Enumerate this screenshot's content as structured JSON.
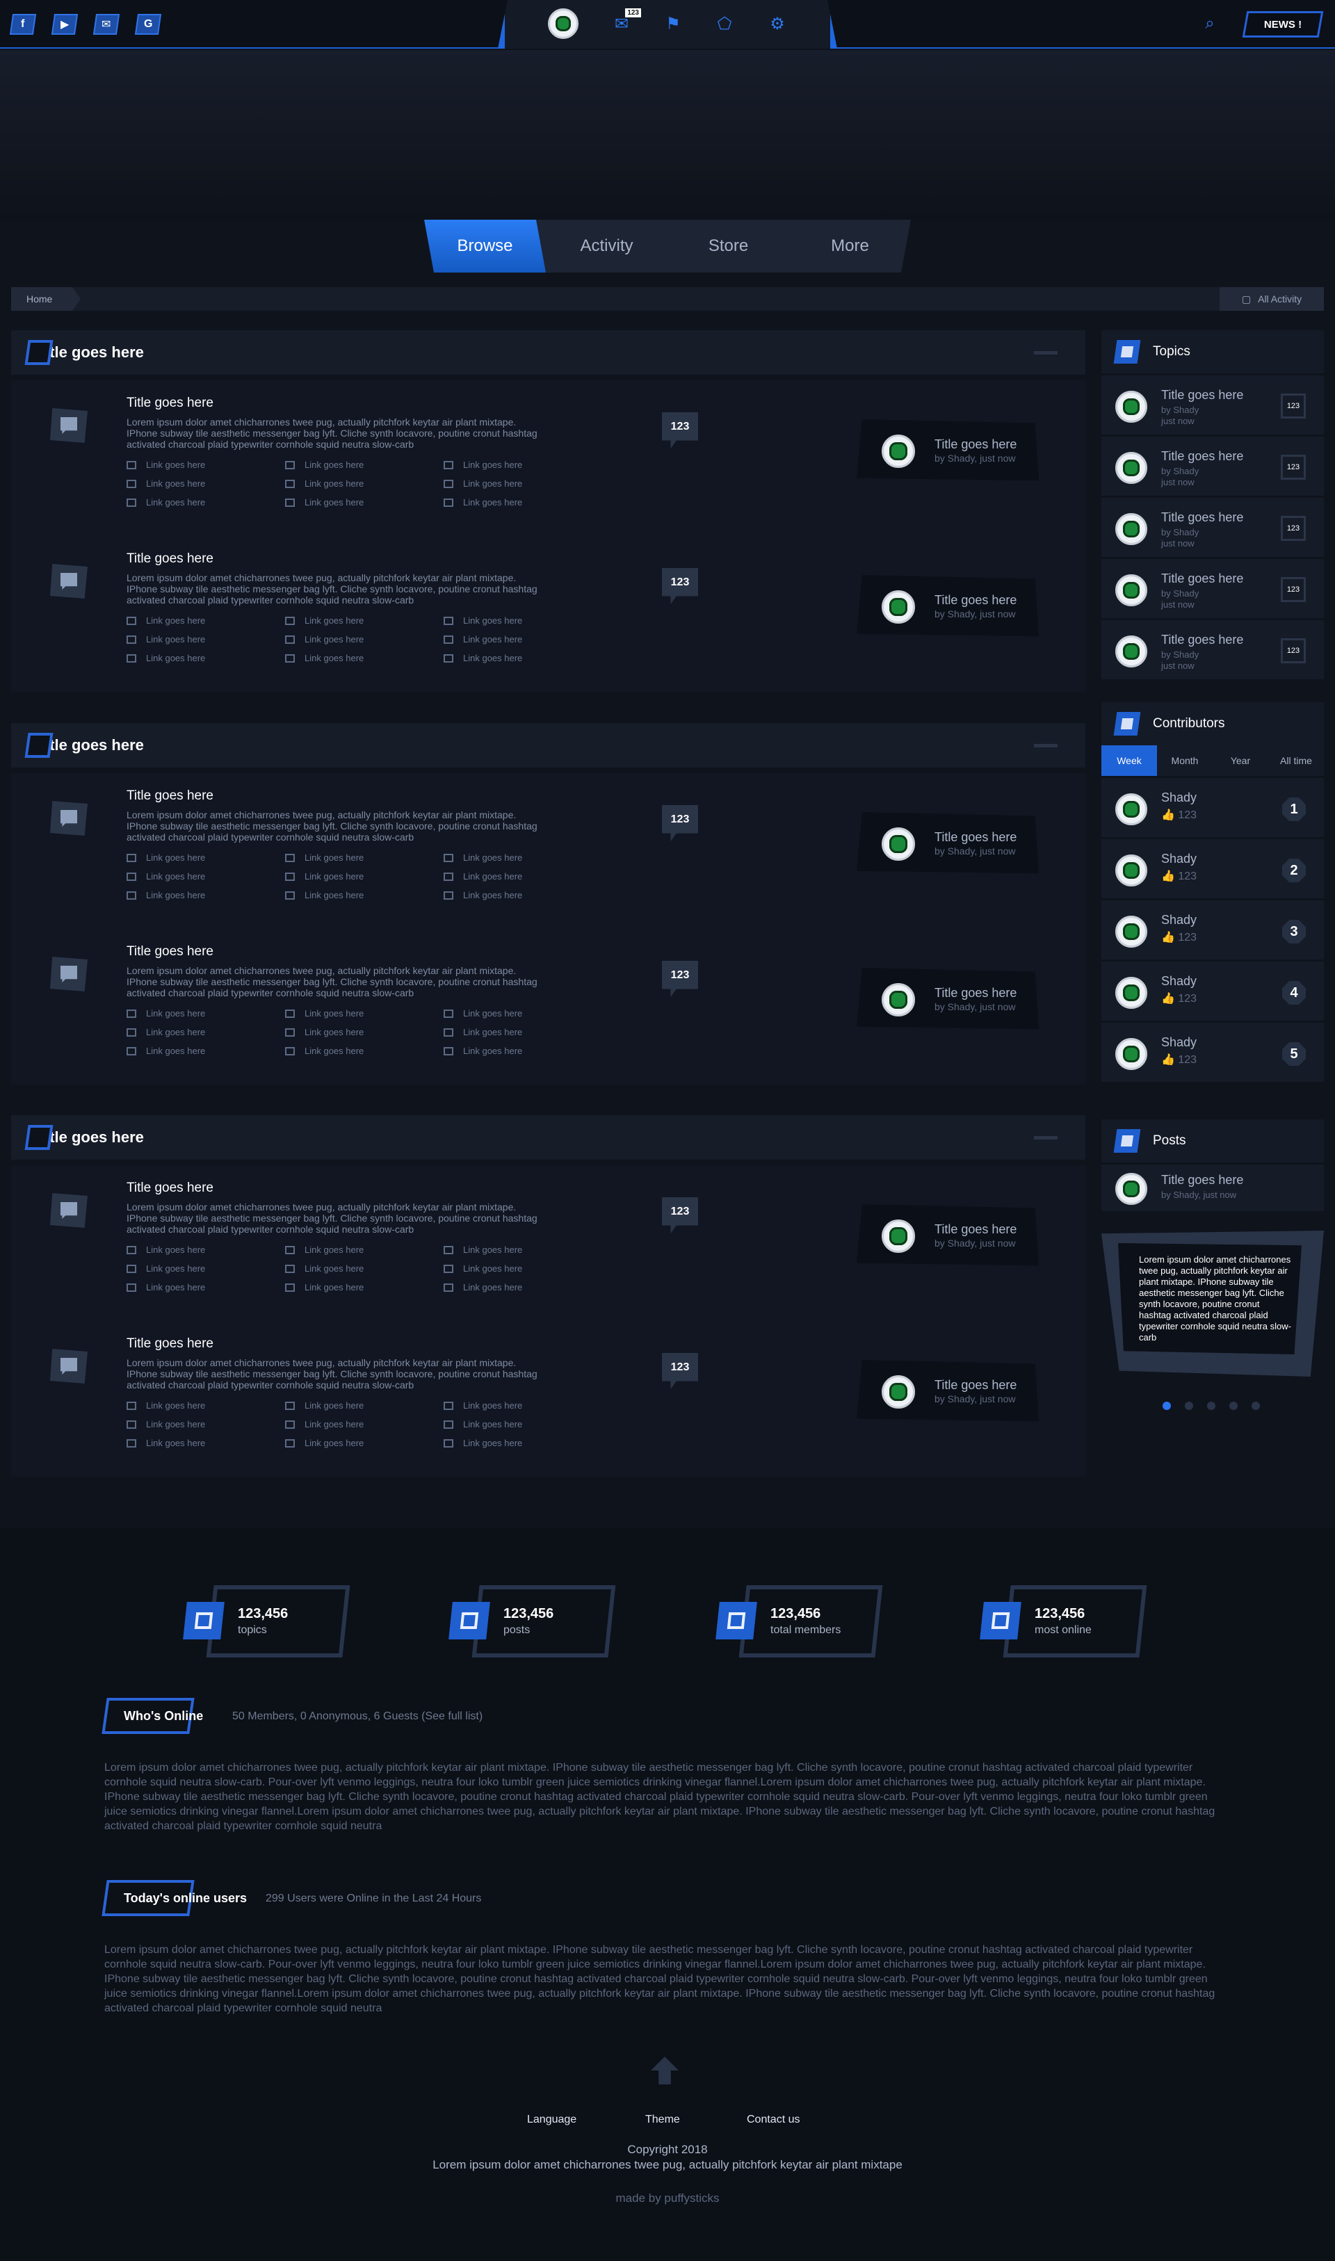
{
  "topbar": {
    "social": [
      "f",
      "▶",
      "✉",
      "G"
    ],
    "messages_badge": "123",
    "news_label": "NEWS",
    "news_mark": "!"
  },
  "nav": {
    "tabs": [
      "Browse",
      "Activity",
      "Store",
      "More"
    ],
    "active": "Browse"
  },
  "breadcrumb": {
    "home": "Home",
    "all_activity": "All Activity"
  },
  "categories": [
    {
      "title": "Title goes here",
      "forums": [
        {
          "title": "Title goes here",
          "desc": "Lorem ipsum dolor amet chicharrones twee pug, actually pitchfork keytar air plant mixtape. IPhone subway tile aesthetic messenger bag lyft. Cliche synth locavore, poutine cronut hashtag activated charcoal plaid typewriter cornhole squid neutra slow-carb",
          "count": "123",
          "last_title": "Title goes here",
          "last_by": "by Shady, just now"
        },
        {
          "title": "Title goes here",
          "desc": "Lorem ipsum dolor amet chicharrones twee pug, actually pitchfork keytar air plant mixtape. IPhone subway tile aesthetic messenger bag lyft. Cliche synth locavore, poutine cronut hashtag activated charcoal plaid typewriter cornhole squid neutra slow-carb",
          "count": "123",
          "last_title": "Title goes here",
          "last_by": "by Shady, just now"
        }
      ]
    },
    {
      "title": "Title goes here",
      "forums": [
        {
          "title": "Title goes here",
          "desc": "Lorem ipsum dolor amet chicharrones twee pug, actually pitchfork keytar air plant mixtape. IPhone subway tile aesthetic messenger bag lyft. Cliche synth locavore, poutine cronut hashtag activated charcoal plaid typewriter cornhole squid neutra slow-carb",
          "count": "123",
          "last_title": "Title goes here",
          "last_by": "by Shady, just now"
        },
        {
          "title": "Title goes here",
          "desc": "Lorem ipsum dolor amet chicharrones twee pug, actually pitchfork keytar air plant mixtape. IPhone subway tile aesthetic messenger bag lyft. Cliche synth locavore, poutine cronut hashtag activated charcoal plaid typewriter cornhole squid neutra slow-carb",
          "count": "123",
          "last_title": "Title goes here",
          "last_by": "by Shady, just now"
        }
      ]
    },
    {
      "title": "Title goes here",
      "forums": [
        {
          "title": "Title goes here",
          "desc": "Lorem ipsum dolor amet chicharrones twee pug, actually pitchfork keytar air plant mixtape. IPhone subway tile aesthetic messenger bag lyft. Cliche synth locavore, poutine cronut hashtag activated charcoal plaid typewriter cornhole squid neutra slow-carb",
          "count": "123",
          "last_title": "Title goes here",
          "last_by": "by Shady, just now"
        },
        {
          "title": "Title goes here",
          "desc": "Lorem ipsum dolor amet chicharrones twee pug, actually pitchfork keytar air plant mixtape. IPhone subway tile aesthetic messenger bag lyft. Cliche synth locavore, poutine cronut hashtag activated charcoal plaid typewriter cornhole squid neutra slow-carb",
          "count": "123",
          "last_title": "Title goes here",
          "last_by": "by Shady, just now"
        }
      ]
    }
  ],
  "link_label": "Link goes here",
  "topics": {
    "title": "Topics",
    "items": [
      {
        "title": "Title goes here",
        "by": "by Shady",
        "when": "just now",
        "count": "123"
      },
      {
        "title": "Title goes here",
        "by": "by Shady",
        "when": "just now",
        "count": "123"
      },
      {
        "title": "Title goes here",
        "by": "by Shady",
        "when": "just now",
        "count": "123"
      },
      {
        "title": "Title goes here",
        "by": "by Shady",
        "when": "just now",
        "count": "123"
      },
      {
        "title": "Title goes here",
        "by": "by Shady",
        "when": "just now",
        "count": "123"
      }
    ]
  },
  "contributors": {
    "title": "Contributors",
    "tabs": [
      "Week",
      "Month",
      "Year",
      "All time"
    ],
    "active": "Week",
    "items": [
      {
        "name": "Shady",
        "likes": "123",
        "rank": "1"
      },
      {
        "name": "Shady",
        "likes": "123",
        "rank": "2"
      },
      {
        "name": "Shady",
        "likes": "123",
        "rank": "3"
      },
      {
        "name": "Shady",
        "likes": "123",
        "rank": "4"
      },
      {
        "name": "Shady",
        "likes": "123",
        "rank": "5"
      }
    ]
  },
  "posts": {
    "title": "Posts",
    "item": {
      "title": "Title goes here",
      "by": "by Shady, just now"
    },
    "quote": "Lorem ipsum dolor amet chicharrones twee pug, actually pitchfork keytar air plant mixtape. IPhone subway tile aesthetic messenger bag lyft. Cliche synth locavore, poutine cronut hashtag activated charcoal plaid typewriter cornhole squid neutra slow-carb",
    "dots": 5,
    "active_dot": 1
  },
  "stats": [
    {
      "value": "123,456",
      "label": "topics"
    },
    {
      "value": "123,456",
      "label": "posts"
    },
    {
      "value": "123,456",
      "label": "total members"
    },
    {
      "value": "123,456",
      "label": "most online"
    }
  ],
  "whos_online": {
    "title": "Who's Online",
    "subtitle": "50 Members, 0 Anonymous, 6 Guests (See full list)",
    "text": "Lorem ipsum dolor amet chicharrones twee pug, actually pitchfork keytar air plant mixtape. IPhone subway tile aesthetic messenger bag lyft. Cliche synth locavore, poutine cronut hashtag activated charcoal plaid typewriter cornhole squid neutra slow-carb. Pour-over lyft venmo leggings, neutra four loko tumblr green juice semiotics drinking vinegar flannel.Lorem ipsum dolor amet chicharrones twee pug, actually pitchfork keytar air plant mixtape. IPhone subway tile aesthetic messenger bag lyft. Cliche synth locavore, poutine cronut hashtag activated charcoal plaid typewriter cornhole squid neutra slow-carb. Pour-over lyft venmo leggings, neutra four loko tumblr green juice semiotics drinking vinegar flannel.Lorem ipsum dolor amet chicharrones twee pug, actually pitchfork keytar air plant mixtape. IPhone subway tile aesthetic messenger bag lyft. Cliche synth locavore, poutine cronut hashtag activated charcoal plaid typewriter cornhole squid neutra"
  },
  "today_online": {
    "title": "Today's online users",
    "subtitle": "299 Users were Online in the Last 24 Hours",
    "text": "Lorem ipsum dolor amet chicharrones twee pug, actually pitchfork keytar air plant mixtape. IPhone subway tile aesthetic messenger bag lyft. Cliche synth locavore, poutine cronut hashtag activated charcoal plaid typewriter cornhole squid neutra slow-carb. Pour-over lyft venmo leggings, neutra four loko tumblr green juice semiotics drinking vinegar flannel.Lorem ipsum dolor amet chicharrones twee pug, actually pitchfork keytar air plant mixtape. IPhone subway tile aesthetic messenger bag lyft. Cliche synth locavore, poutine cronut hashtag activated charcoal plaid typewriter cornhole squid neutra slow-carb. Pour-over lyft venmo leggings, neutra four loko tumblr green juice semiotics drinking vinegar flannel.Lorem ipsum dolor amet chicharrones twee pug, actually pitchfork keytar air plant mixtape. IPhone subway tile aesthetic messenger bag lyft. Cliche synth locavore, poutine cronut hashtag activated charcoal plaid typewriter cornhole squid neutra"
  },
  "footer": {
    "links": [
      "Language",
      "Theme",
      "Contact us"
    ],
    "copyright": "Copyright 2018",
    "tagline": "Lorem ipsum dolor amet chicharrones twee pug, actually pitchfork keytar air plant mixtape",
    "credit": "made by puffysticks"
  },
  "colors": {
    "accent": "#1f63d8",
    "bg": "#0f131c",
    "panel": "#141a26"
  }
}
